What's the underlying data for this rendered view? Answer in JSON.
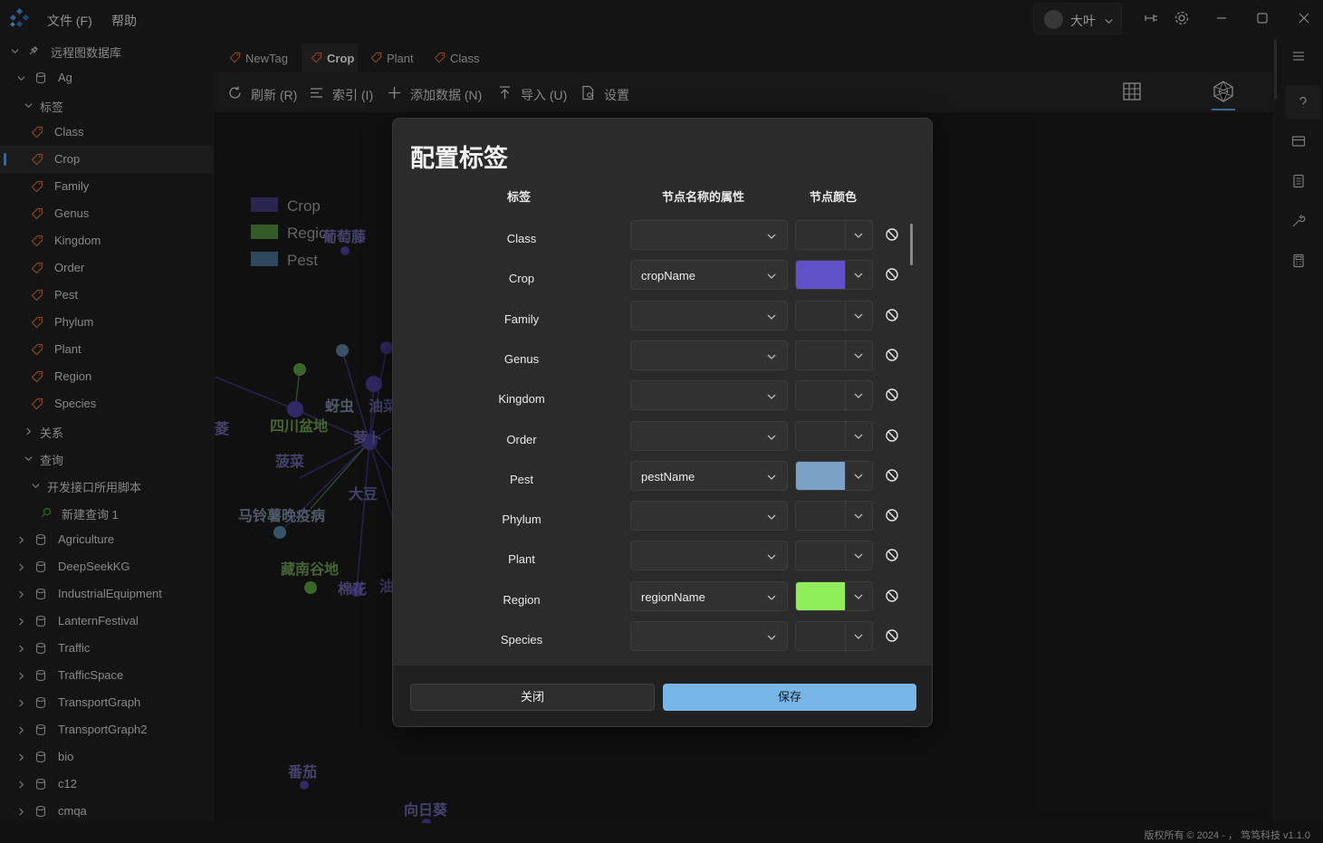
{
  "titlebar": {
    "menu_file": "文件 (F)",
    "menu_help": "帮助",
    "user_name": "大叶",
    "icons": [
      "app-logo-icon",
      "pin-icon",
      "gear-icon",
      "minimize-icon",
      "maximize-icon",
      "close-icon"
    ]
  },
  "sidebar": {
    "root": "远程图数据库",
    "db_ag": "Ag",
    "tags_group": "标签",
    "tags": [
      "Class",
      "Crop",
      "Family",
      "Genus",
      "Kingdom",
      "Order",
      "Pest",
      "Phylum",
      "Plant",
      "Region",
      "Species"
    ],
    "selected_tag": "Crop",
    "relations_group": "关系",
    "query_group": "查询",
    "query_folder": "开发接口所用脚本",
    "query_item": "新建查询 1",
    "databases": [
      "Agriculture",
      "DeepSeekKG",
      "IndustrialEquipment",
      "LanternFestival",
      "Traffic",
      "TrafficSpace",
      "TransportGraph",
      "TransportGraph2",
      "bio",
      "c12",
      "cmqa"
    ]
  },
  "tabs": [
    "NewTag",
    "Crop",
    "Plant",
    "Class"
  ],
  "active_tab": "Crop",
  "toolbar": {
    "refresh": "刷新 (R)",
    "index": "索引 (I)",
    "add_data": "添加数据 (N)",
    "import": "导入 (U)",
    "settings": "设置"
  },
  "graph": {
    "legend": [
      {
        "label": "Crop",
        "color": "#3f3a7a"
      },
      {
        "label": "Region",
        "color": "#4f8a3c"
      },
      {
        "label": "Pest",
        "color": "#4b6f8c"
      }
    ],
    "legend_region_partial": "Regio",
    "node_labels": [
      "葡萄藤",
      "蚜虫",
      "油菜",
      "四川盆地",
      "萝卜",
      "菠菜",
      "大豆",
      "马铃薯晚疫病",
      "藏南谷地",
      "棉花",
      "油",
      "番茄",
      "向日葵",
      "菱"
    ],
    "colors": {
      "crop": "#4a3f99",
      "region": "#5a9a3e",
      "pest": "#5a7f9c",
      "crop_text": "#6a64a8",
      "region_text": "#6a9a4e",
      "pest_text": "#7a8aa0"
    }
  },
  "dialog": {
    "title": "配置标签",
    "col_tag": "标签",
    "col_prop": "节点名称的属性",
    "col_color": "节点颜色",
    "rows": [
      {
        "tag": "Class",
        "prop": "",
        "color": ""
      },
      {
        "tag": "Crop",
        "prop": "cropName",
        "color": "#6150c8"
      },
      {
        "tag": "Family",
        "prop": "",
        "color": ""
      },
      {
        "tag": "Genus",
        "prop": "",
        "color": ""
      },
      {
        "tag": "Kingdom",
        "prop": "",
        "color": ""
      },
      {
        "tag": "Order",
        "prop": "",
        "color": ""
      },
      {
        "tag": "Pest",
        "prop": "pestName",
        "color": "#7ba2c6"
      },
      {
        "tag": "Phylum",
        "prop": "",
        "color": ""
      },
      {
        "tag": "Plant",
        "prop": "",
        "color": ""
      },
      {
        "tag": "Region",
        "prop": "regionName",
        "color": "#90ee5a"
      },
      {
        "tag": "Species",
        "prop": "",
        "color": ""
      }
    ],
    "close_label": "关闭",
    "save_label": "保存"
  },
  "status": {
    "text": "版权所有 © 2024 - ， 笃笃科技  v1.1.0"
  }
}
